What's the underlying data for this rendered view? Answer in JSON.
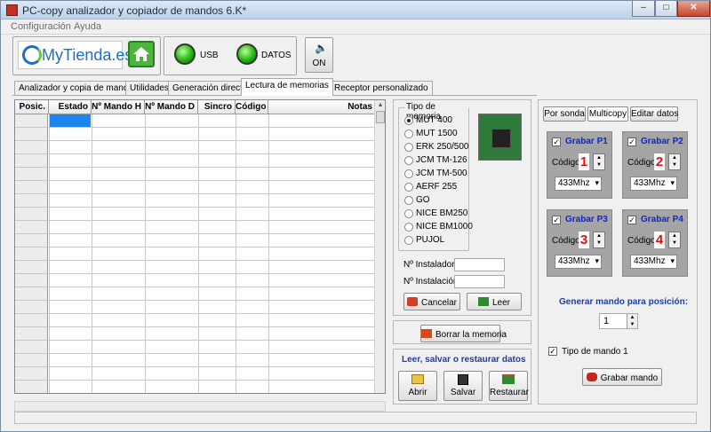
{
  "window": {
    "title": "PC-copy analizador y copiador de mandos 6.K*",
    "min": "–",
    "max": "□",
    "close": "✕"
  },
  "menu": [
    "Configuración",
    "Ayuda"
  ],
  "toolbar": {
    "logo": "MyTienda.es",
    "usb": "USB",
    "datos": "DATOS",
    "sound": "ON"
  },
  "tabs": [
    "Analizador y copia de mandos",
    "Utilidades",
    "Generación directa",
    "Lectura de memorias",
    "Receptor personalizado"
  ],
  "active_tab": 3,
  "grid": {
    "columns": [
      "Posic.",
      "Estado",
      "Nº Mando H",
      "Nº Mando D",
      "Sincro",
      "Código",
      "Notas"
    ]
  },
  "memoria": {
    "legend": "Tipo de memoria",
    "options": [
      "MUT 400",
      "MUT 1500",
      "ERK 250/500",
      "JCM TM-126",
      "JCM TM-500",
      "AERF 255",
      "GO",
      "NICE BM250",
      "NICE BM1000",
      "PUJOL"
    ],
    "selected": 0
  },
  "fields": {
    "instalador": "Nº Instalador",
    "instalacion": "Nº Instalación"
  },
  "buttons": {
    "cancelar": "Cancelar",
    "leer": "Leer",
    "borrar": "Borrar la memoria",
    "abrir": "Abrir",
    "salvar": "Salvar",
    "restaurar": "Restaurar",
    "grabar_mando": "Grabar mando"
  },
  "lsr_title": "Leer, salvar o restaurar datos",
  "right_tabs": [
    "Por sonda",
    "Multicopy",
    "Editar datos"
  ],
  "right_active": 1,
  "grabar": [
    {
      "title": "Grabar P1",
      "label": "Código:",
      "code": "1",
      "freq": "433Mhz",
      "checked": "✓"
    },
    {
      "title": "Grabar P2",
      "label": "Código:",
      "code": "2",
      "freq": "433Mhz",
      "checked": "✓"
    },
    {
      "title": "Grabar P3",
      "label": "Código:",
      "code": "3",
      "freq": "433Mhz",
      "checked": "✓"
    },
    {
      "title": "Grabar P4",
      "label": "Código:",
      "code": "4",
      "freq": "433Mhz",
      "checked": "✓"
    }
  ],
  "generar": {
    "title": "Generar mando para posición:",
    "value": "1"
  },
  "tipo_mando": {
    "label": "Tipo de mando 1",
    "checked": "✓"
  },
  "colors": {
    "accent": "#1c86f0",
    "led": "#26b70f",
    "code_red": "#e01010",
    "title_blue": "#1027c4"
  }
}
